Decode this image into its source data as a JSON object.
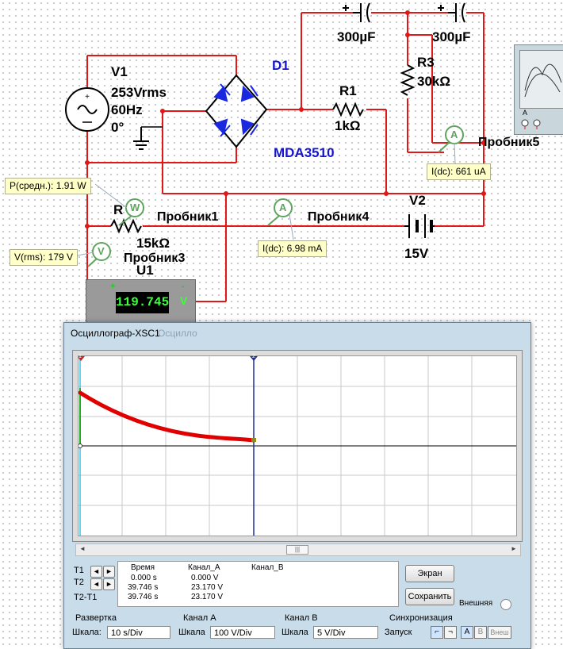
{
  "schematic": {
    "v1_name": "V1",
    "v1_voltage": "253Vrms",
    "v1_freq": "60Hz",
    "v1_phase": "0°",
    "d1_name": "D1",
    "d1_model": "MDA3510",
    "r1_name": "R1",
    "r1_value": "1kΩ",
    "r3_name": "R3",
    "r3_value": "30kΩ",
    "r_name": "R",
    "r_value": "15kΩ",
    "c_left_value": "300µF",
    "c_right_value": "300µF",
    "v2_name": "V2",
    "v2_value": "15V",
    "u1_name": "U1",
    "u1_reading": "119.745",
    "u1_unit": "V",
    "probe1_name": "Пробник1",
    "probe3_name": "Пробник3",
    "probe4_name": "Пробник4",
    "probe5_name": "Пробник5",
    "probe_power_label": "P(средн.): 1.91 W",
    "probe_vrms_label": "V(rms): 179 V",
    "probe_idc4_label": "I(dc): 6.98 mA",
    "probe_idc5_label": "I(dc): 661 uA",
    "ammeter_glyph": "A",
    "wattmeter_glyph": "W",
    "voltmeter_glyph": "V",
    "mini_scope_a": "A"
  },
  "oscilloscope": {
    "title": "Осциллограф-XSC1",
    "title_ghost": "Осцилло",
    "cursor1": "1",
    "cursor2": "2",
    "t1_label": "T1",
    "t2_label": "T2",
    "t2t1_label": "T2-T1",
    "col_time": "Время",
    "col_ch_a": "Канал_A",
    "col_ch_b": "Канал_B",
    "rows": [
      {
        "time": "0.000 s",
        "a": "0.000 V"
      },
      {
        "time": "39.746 s",
        "a": "23.170 V"
      },
      {
        "time": "39.746 s",
        "a": "23.170 V"
      }
    ],
    "btn_screen": "Экран",
    "btn_save": "Сохранить",
    "external_label": "Внешняя",
    "sweep_title": "Развертка",
    "sweep_scale_label": "Шкала:",
    "sweep_scale_value": "10  s/Div",
    "cha_title": "Канал A",
    "cha_scale_label": "Шкала",
    "cha_scale_value": "100  V/Div",
    "chb_title": "Канал B",
    "chb_scale_label": "Шкала",
    "chb_scale_value": "5  V/Div",
    "sync_title": "Синхронизация",
    "sync_trigger_label": "Запуск",
    "sync_btn_a": "A",
    "sync_btn_b": "B",
    "sync_btn_ext": "Внеш",
    "trace_color": "#e00000"
  }
}
